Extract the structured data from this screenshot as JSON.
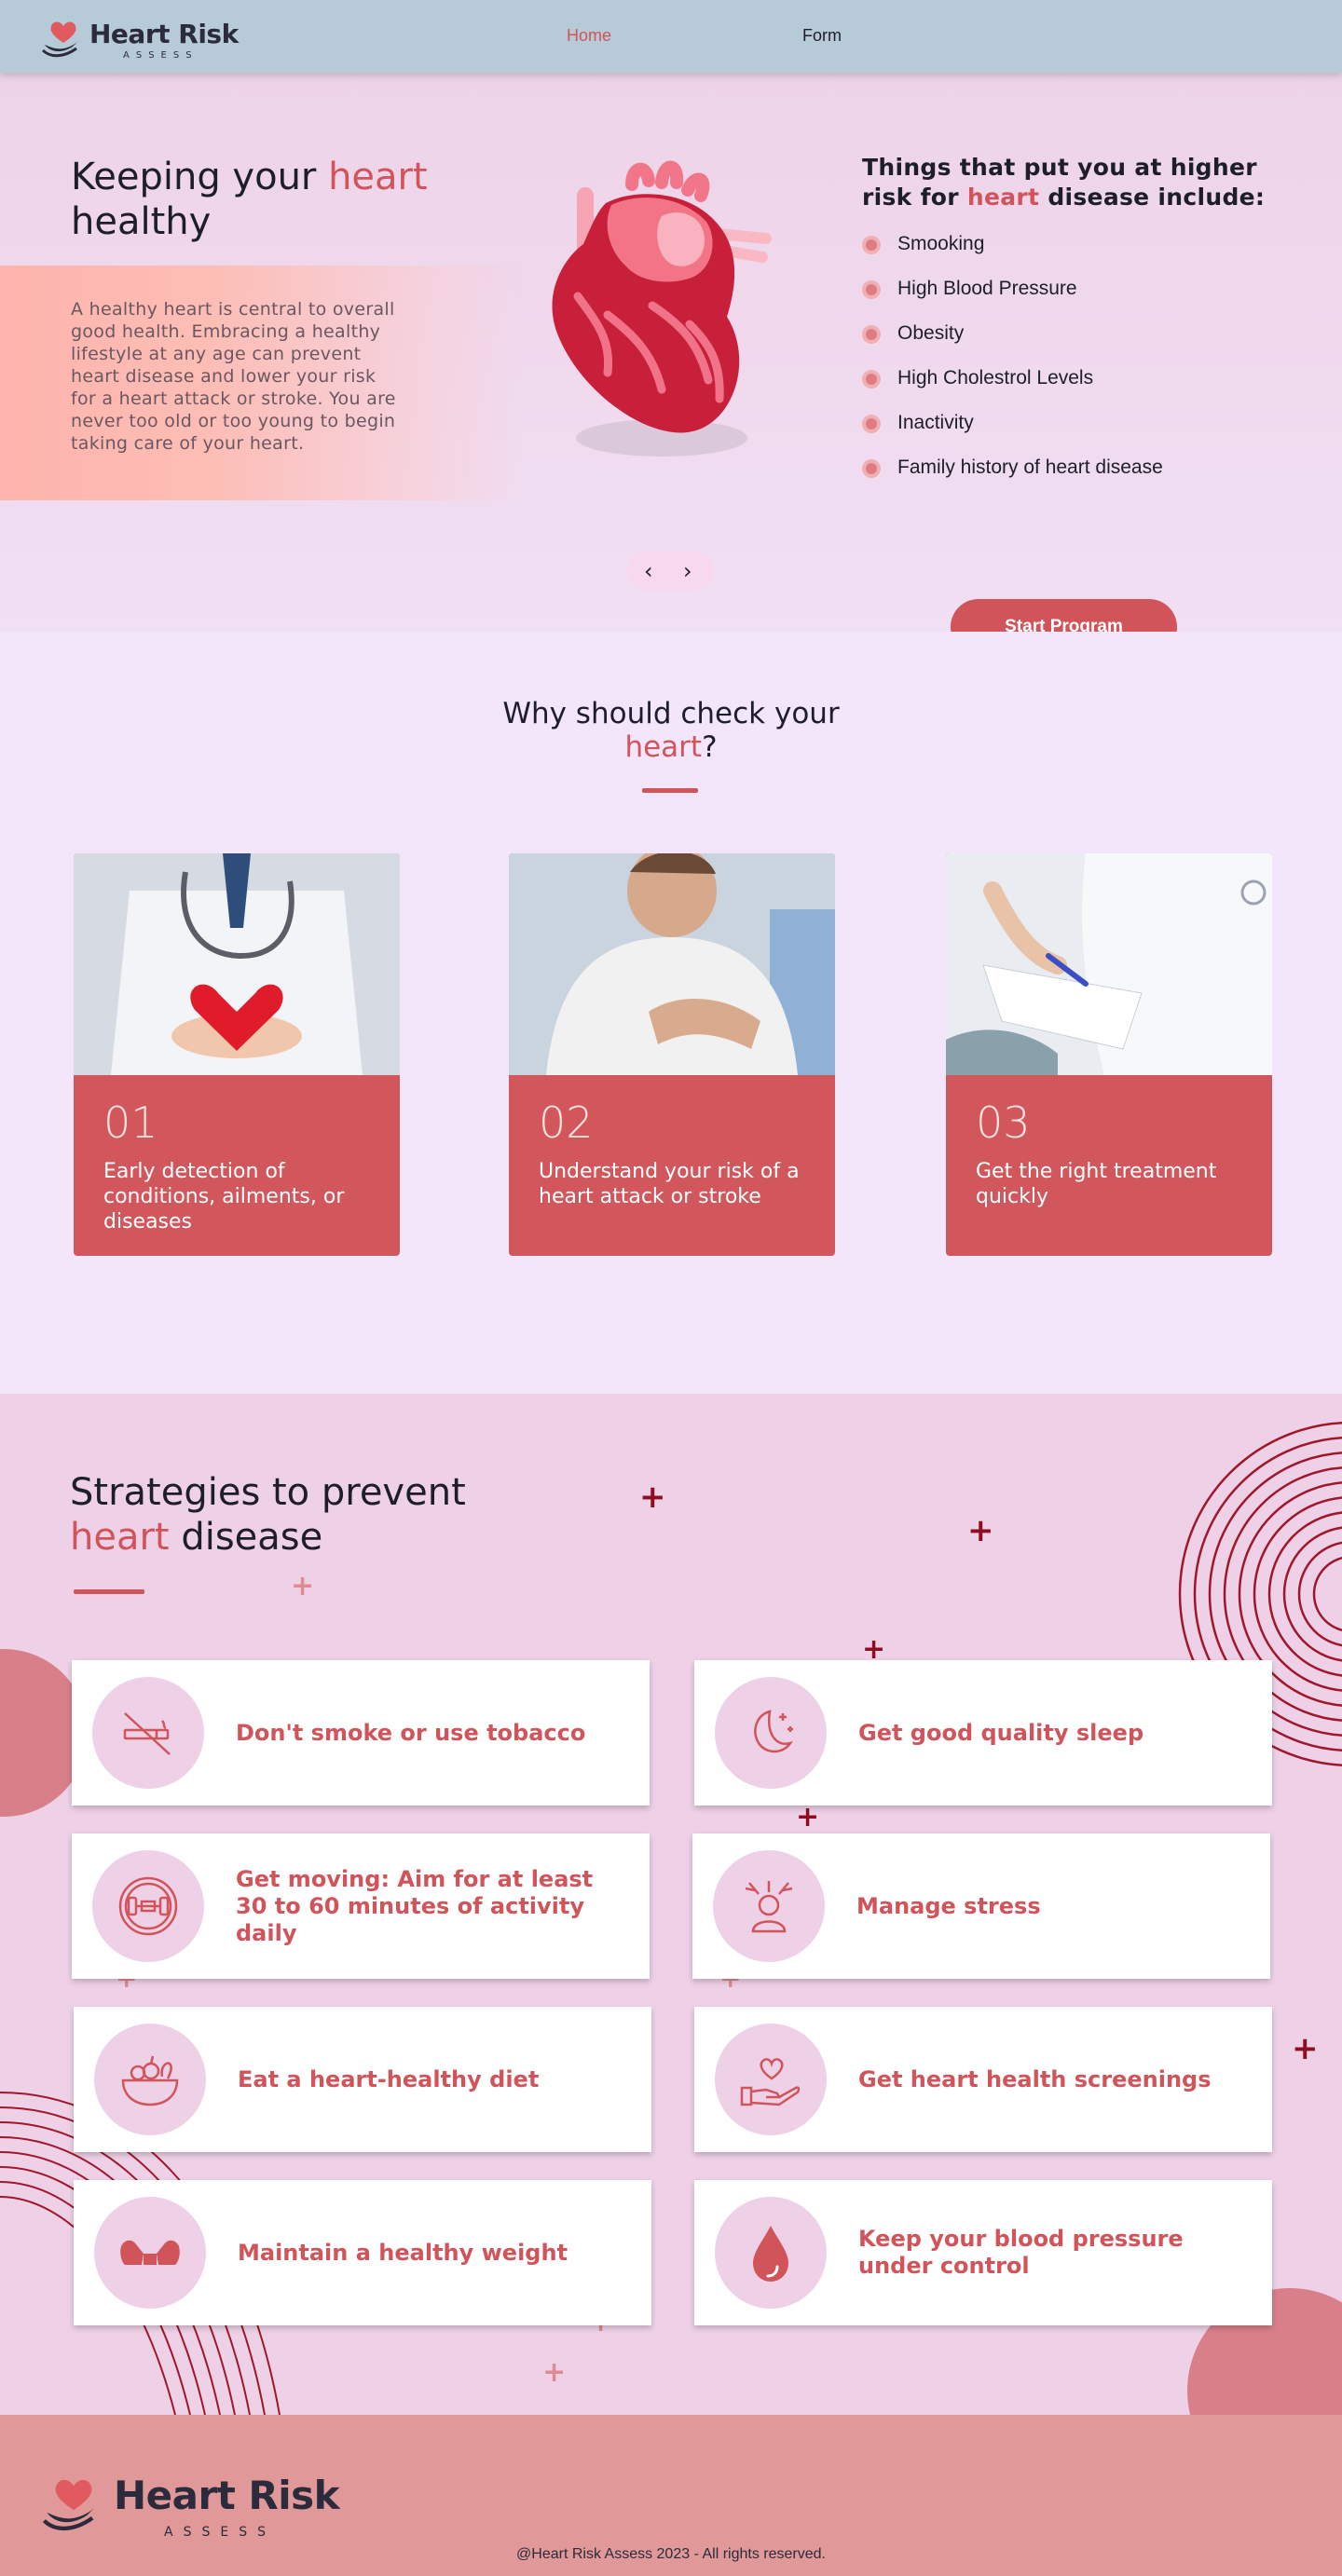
{
  "nav": {
    "brand": "Heart Risk",
    "brand_sub": "ASSESS",
    "links": [
      "Home",
      "Form"
    ],
    "active": "Home"
  },
  "hero": {
    "title_pre": "Keeping your ",
    "title_accent": "heart",
    "title_post": " healthy",
    "description": "A healthy heart is central to overall good health. Embracing a healthy lifestyle at any age can prevent heart disease and lower your risk for a heart attack or stroke. You are never too old or too young to begin taking care of your heart.",
    "slider_prev": "‹",
    "slider_next": "›",
    "risk_title_pre": "Things that put you at higher risk for ",
    "risk_title_accent": "heart",
    "risk_title_post": " disease include:",
    "risks": [
      "Smooking",
      "High Blood Pressure",
      "Obesity",
      "High Cholestrol Levels",
      "Inactivity",
      "Family history of heart disease"
    ],
    "cta": "Start Program"
  },
  "why": {
    "title_pre": "Why should check your ",
    "title_accent": "heart",
    "title_post": "?",
    "cards": [
      {
        "num": "01",
        "text": "Early detection of conditions, ailments, or diseases"
      },
      {
        "num": "02",
        "text": "Understand your risk of a heart attack or stroke"
      },
      {
        "num": "03",
        "text": "Get the right treatment quickly"
      }
    ]
  },
  "strategies": {
    "title_pre": "Strategies to prevent",
    "title_accent": "heart",
    "title_post": " disease",
    "items": [
      {
        "label": "Don't smoke or use tobacco",
        "icon": "no-smoking-icon"
      },
      {
        "label": "Get good quality sleep",
        "icon": "moon-icon"
      },
      {
        "label": "Get moving: Aim for at least 30 to 60 minutes of activity daily",
        "icon": "dumbbell-icon"
      },
      {
        "label": "Manage stress",
        "icon": "stress-icon"
      },
      {
        "label": "Eat a heart-healthy diet",
        "icon": "fruit-bowl-icon"
      },
      {
        "label": "Get heart health screenings",
        "icon": "heart-hand-icon"
      },
      {
        "label": "Maintain a healthy weight",
        "icon": "muscle-icon"
      },
      {
        "label": "Keep your blood pressure under control",
        "icon": "blood-drop-icon"
      }
    ]
  },
  "footer": {
    "brand": "Heart Risk",
    "brand_sub": "ASSESS",
    "copyright": "@Heart Risk Assess 2023 - All rights reserved."
  },
  "colors": {
    "accent": "#d1545b",
    "nav_bg": "#b7cad8",
    "footer_bg": "#e09898",
    "card_bg": "#d1575c"
  }
}
